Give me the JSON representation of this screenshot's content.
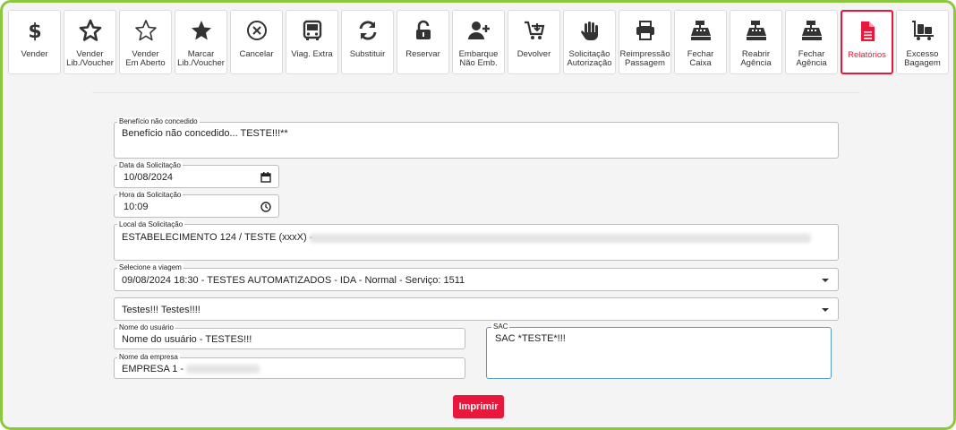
{
  "toolbar": {
    "buttons": [
      {
        "label": "Vender",
        "icon": "dollar-icon"
      },
      {
        "label": "Vender\nLib./Voucher",
        "icon": "star-solid-icon"
      },
      {
        "label": "Vender\nEm Aberto",
        "icon": "star-outline-icon"
      },
      {
        "label": "Marcar\nLib./Voucher",
        "icon": "star-filled-icon"
      },
      {
        "label": "Cancelar",
        "icon": "cancel-circle-icon"
      },
      {
        "label": "Viag. Extra",
        "icon": "bus-icon"
      },
      {
        "label": "Substituir",
        "icon": "sync-icon"
      },
      {
        "label": "Reservar",
        "icon": "unlock-icon"
      },
      {
        "label": "Embarque\nNão Emb.",
        "icon": "user-plus-icon"
      },
      {
        "label": "Devolver",
        "icon": "cart-return-icon"
      },
      {
        "label": "Solicitação\nAutorização",
        "icon": "hand-icon"
      },
      {
        "label": "Reimpressão\nPassagem",
        "icon": "printer-icon"
      },
      {
        "label": "Fechar\nCaixa",
        "icon": "cash-register-icon"
      },
      {
        "label": "Reabrir\nAgência",
        "icon": "cash-register-icon"
      },
      {
        "label": "Fechar\nAgência",
        "icon": "cash-register-icon"
      },
      {
        "label": "Relatórios",
        "icon": "report-file-icon"
      },
      {
        "label": "Excesso\nBagagem",
        "icon": "luggage-cart-icon"
      }
    ],
    "active_color": "#e8173b"
  },
  "form": {
    "beneficio": {
      "label": "Benefício não concedido",
      "value": "Benefício não concedido... TESTE!!!**"
    },
    "data": {
      "label": "Data da Solicitação",
      "value": "10/08/2024"
    },
    "hora": {
      "label": "Hora da Solicitação",
      "value": "10:09"
    },
    "local": {
      "label": "Local da Solicitação",
      "value": "ESTABELECIMENTO 124 / TESTE (xxxX) -"
    },
    "viagem": {
      "label": "Selecione a viagem",
      "value": "09/08/2024 18:30 - TESTES AUTOMATIZADOS - IDA - Normal - Serviço: 1511"
    },
    "testes": {
      "value": "Testes!!! Testes!!!!"
    },
    "usuario": {
      "label": "Nome do usuário",
      "value": "Nome do usuário - TESTES!!!"
    },
    "empresa": {
      "label": "Nome da empresa",
      "value": "EMPRESA 1 -"
    },
    "sac": {
      "label": "SAC",
      "value": "SAC *TESTE*!!!"
    }
  },
  "actions": {
    "print_label": "Imprimir"
  },
  "colors": {
    "frame": "#8dc63f",
    "accent": "#e8173b",
    "focus": "#5b9bd5"
  }
}
